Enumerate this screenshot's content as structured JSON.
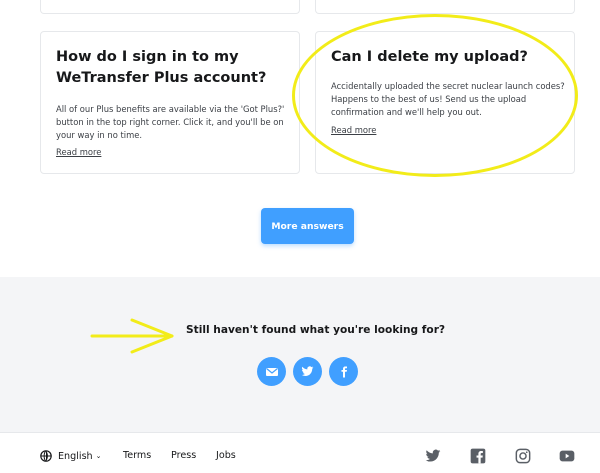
{
  "faq": {
    "cards": [
      {
        "title": "How do I sign in to my WeTransfer Plus account?",
        "body": "All of our Plus benefits are available via the 'Got Plus?' button in the top right corner. Click it, and you'll be on your way in no time.",
        "read_more": "Read more"
      },
      {
        "title": "Can I delete my upload?",
        "body": "Accidentally uploaded the secret nuclear launch codes? Happens to the best of us! Send us the upload confirmation and we'll help you out.",
        "read_more": "Read more"
      }
    ],
    "more_answers_label": "More answers"
  },
  "help": {
    "title": "Still haven't found what you're looking for?",
    "social": [
      {
        "name": "mail-icon"
      },
      {
        "name": "twitter-icon"
      },
      {
        "name": "facebook-icon"
      }
    ]
  },
  "footer": {
    "language": "English",
    "links": {
      "terms": "Terms",
      "press": "Press",
      "jobs": "Jobs"
    },
    "icons": [
      "twitter-icon",
      "facebook-icon",
      "instagram-icon",
      "youtube-icon"
    ]
  },
  "colors": {
    "accent": "#409fff",
    "annotation": "#f2ec19",
    "band": "#f4f5f7"
  }
}
